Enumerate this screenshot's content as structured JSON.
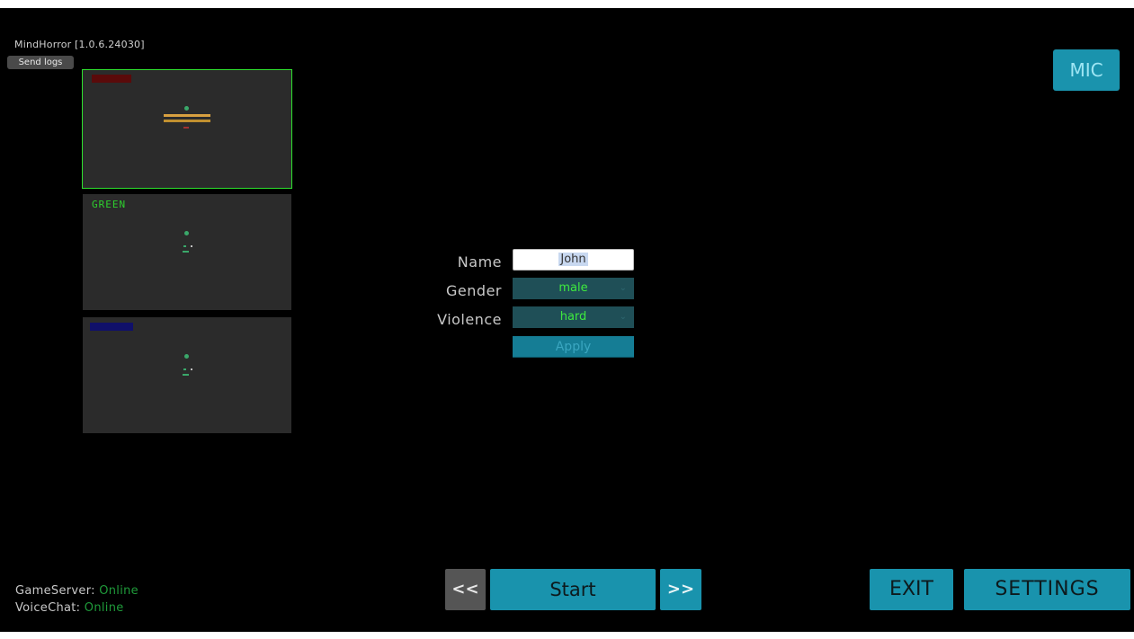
{
  "app": {
    "version_label": "MindHorror [1.0.6.24030]"
  },
  "toolbar": {
    "send_logs_label": "Send logs",
    "mic_label": "MIC"
  },
  "slots": [
    {
      "title": "",
      "title_color": "#c01010"
    },
    {
      "title": "GREEN",
      "title_color": "#2ecf2e"
    },
    {
      "title": "",
      "title_color": "#2030c0"
    }
  ],
  "form": {
    "name_label": "Name",
    "name_value": "John",
    "gender_label": "Gender",
    "gender_value": "male",
    "violence_label": "Violence",
    "violence_value": "hard",
    "apply_label": "Apply"
  },
  "status": {
    "gameserver_label": "GameServer:",
    "gameserver_value": "Online",
    "voicechat_label": "VoiceChat:",
    "voicechat_value": "Online"
  },
  "nav": {
    "prev_label": "<<",
    "start_label": "Start",
    "next_label": ">>",
    "exit_label": "EXIT",
    "settings_label": "SETTINGS"
  },
  "colors": {
    "accent": "#1993ad",
    "online": "#1f9b3a",
    "selected_outline": "#2ee02e"
  }
}
